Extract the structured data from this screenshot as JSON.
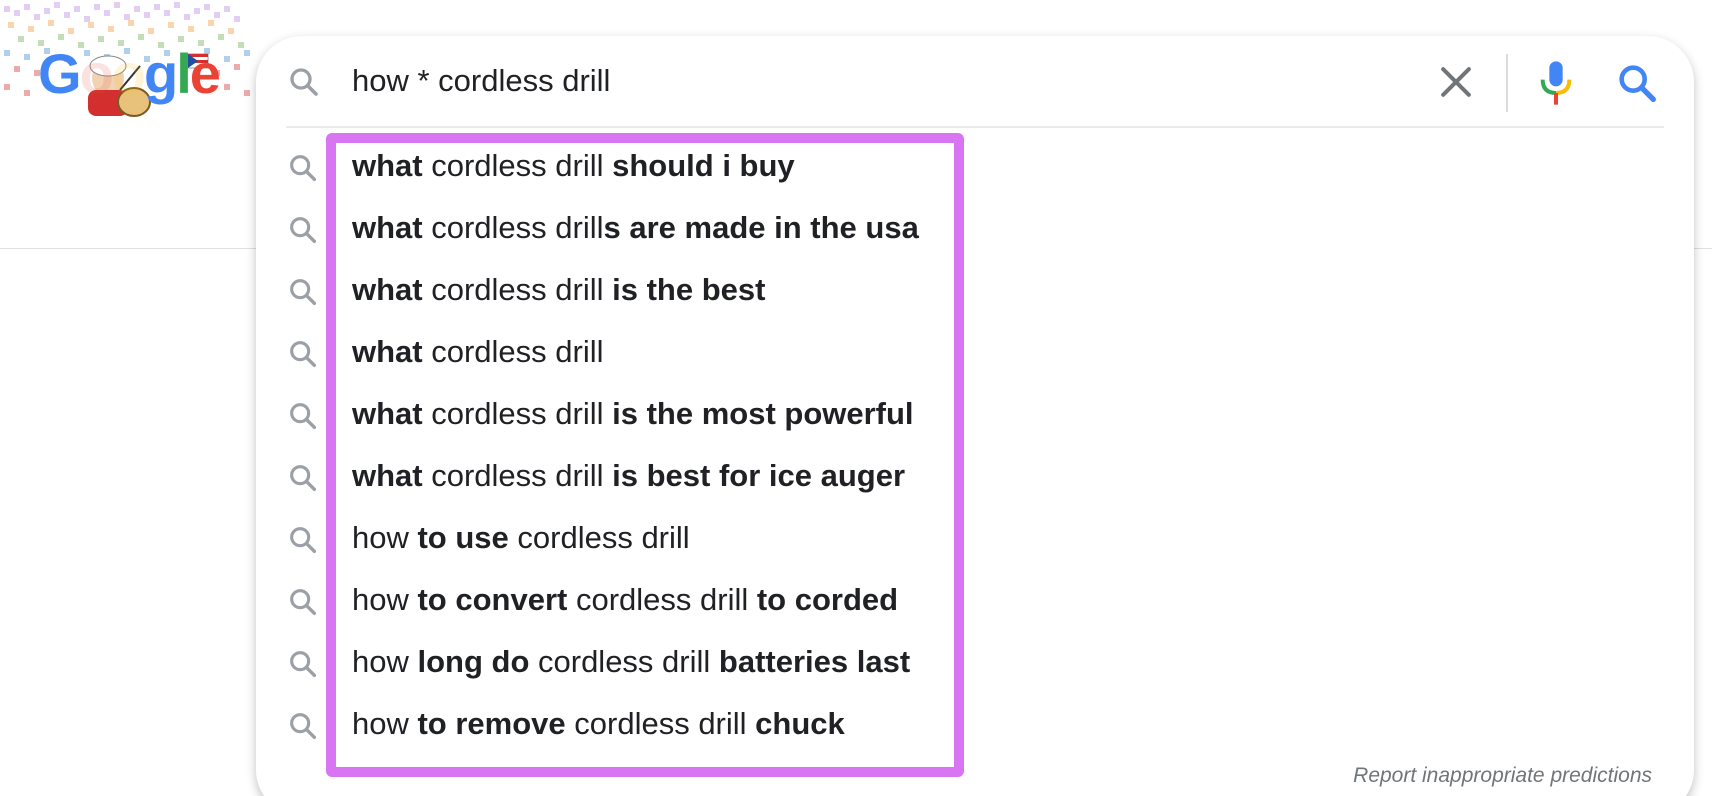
{
  "logo": {
    "letters": [
      "G",
      "o",
      "o",
      "g",
      "l",
      "e"
    ]
  },
  "search": {
    "value": "how * cordless drill",
    "placeholder": ""
  },
  "icons": {
    "search_left": "search-icon",
    "clear": "close-icon",
    "mic": "microphone-icon",
    "search_submit": "search-icon",
    "suggestion": "search-icon"
  },
  "colors": {
    "highlight": "#d975f2",
    "accent_blue": "#4285f4",
    "text": "#202124",
    "muted": "#70757a"
  },
  "suggestions": [
    [
      {
        "t": "what",
        "b": true
      },
      {
        "t": " cordless drill ",
        "b": false
      },
      {
        "t": "should i buy",
        "b": true
      }
    ],
    [
      {
        "t": "what",
        "b": true
      },
      {
        "t": " cordless drill",
        "b": false
      },
      {
        "t": "s are made in the usa",
        "b": true
      }
    ],
    [
      {
        "t": "what",
        "b": true
      },
      {
        "t": " cordless drill ",
        "b": false
      },
      {
        "t": "is the best",
        "b": true
      }
    ],
    [
      {
        "t": "what",
        "b": true
      },
      {
        "t": " cordless drill",
        "b": false
      }
    ],
    [
      {
        "t": "what",
        "b": true
      },
      {
        "t": " cordless drill ",
        "b": false
      },
      {
        "t": "is the most powerful",
        "b": true
      }
    ],
    [
      {
        "t": "what",
        "b": true
      },
      {
        "t": " cordless drill ",
        "b": false
      },
      {
        "t": "is best for ice auger",
        "b": true
      }
    ],
    [
      {
        "t": "how ",
        "b": false
      },
      {
        "t": "to use",
        "b": true
      },
      {
        "t": " cordless drill",
        "b": false
      }
    ],
    [
      {
        "t": "how ",
        "b": false
      },
      {
        "t": "to convert",
        "b": true
      },
      {
        "t": " cordless drill ",
        "b": false
      },
      {
        "t": "to corded",
        "b": true
      }
    ],
    [
      {
        "t": "how ",
        "b": false
      },
      {
        "t": "long do",
        "b": true
      },
      {
        "t": " cordless drill ",
        "b": false
      },
      {
        "t": "batteries last",
        "b": true
      }
    ],
    [
      {
        "t": "how ",
        "b": false
      },
      {
        "t": "to remove",
        "b": true
      },
      {
        "t": " cordless drill ",
        "b": false
      },
      {
        "t": "chuck",
        "b": true
      }
    ]
  ],
  "report_link": "Report inappropriate predictions"
}
